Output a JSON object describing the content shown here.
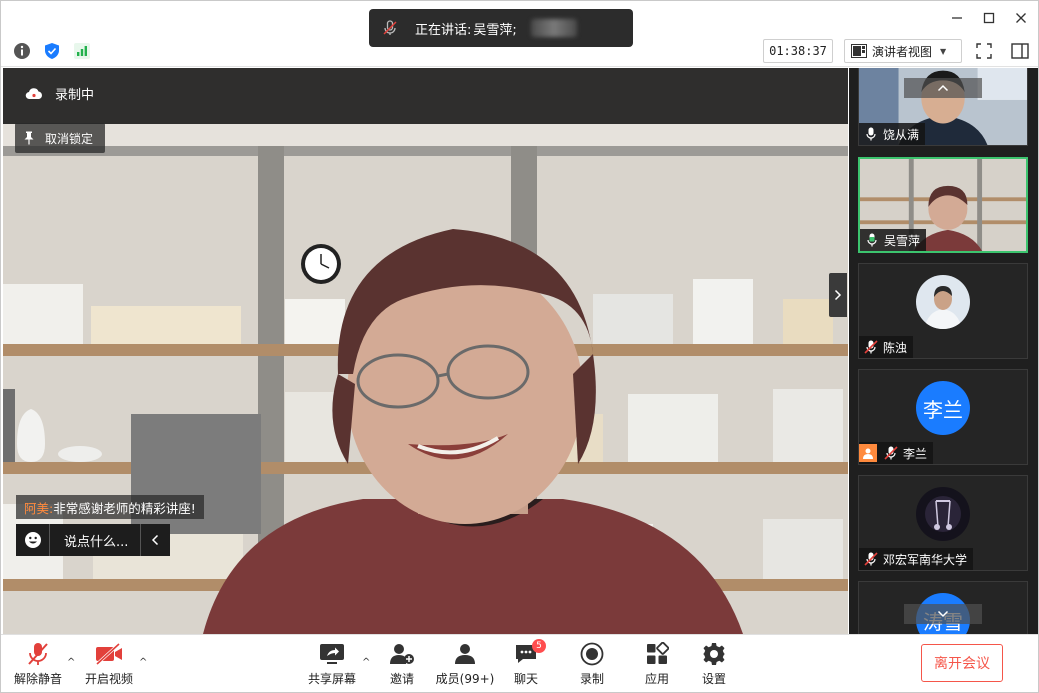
{
  "title_bar": {
    "speaking_label": "正在讲话: ",
    "speaking_name": "吴雪萍;",
    "minimize_icon": "minimize-icon",
    "maximize_icon": "maximize-icon",
    "close_icon": "close-icon"
  },
  "info_bar": {
    "timer": "01:38:37",
    "view_mode": "演讲者视图",
    "colors": {
      "shield": "#1a7cff",
      "signal": "#22b14c"
    }
  },
  "main_video": {
    "recording_label": "录制中",
    "unpin_label": "取消锁定",
    "chat_sender": "阿美:",
    "chat_message": "非常感谢老师的精彩讲座!",
    "chat_placeholder": "说点什么..."
  },
  "participants": [
    {
      "name": "饶从满",
      "mic": "on"
    },
    {
      "name": "吴雪萍",
      "mic": "speaking",
      "active": true
    },
    {
      "name": "陈浊",
      "mic": "muted"
    },
    {
      "name": "李兰",
      "mic": "muted",
      "avatar_text": "李兰",
      "host": true
    },
    {
      "name": "邓宏军南华大学",
      "mic": "muted"
    },
    {
      "name": "",
      "avatar_text": "涛雪"
    }
  ],
  "bottom_bar": {
    "unmute": "解除静音",
    "start_video": "开启视频",
    "share_screen": "共享屏幕",
    "invite": "邀请",
    "members": "成员(99+)",
    "chat": "聊天",
    "chat_badge": "5",
    "record": "录制",
    "apps": "应用",
    "settings": "设置",
    "leave": "离开会议",
    "colors": {
      "leave": "#f5564a",
      "muted": "#e2403b"
    }
  }
}
